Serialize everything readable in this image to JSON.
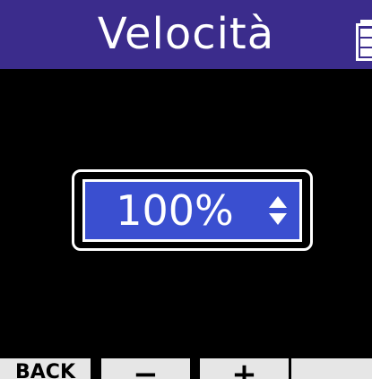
{
  "header": {
    "title": "Velocità",
    "battery_icon": "battery-icon"
  },
  "main": {
    "value": "100%",
    "stepper_icon": "up-down-arrows-icon"
  },
  "softkeys": [
    {
      "label": "BACK"
    },
    {
      "label": "−",
      "icon": "minus-icon"
    },
    {
      "label": "+",
      "icon": "plus-icon"
    },
    {
      "label": ""
    }
  ],
  "colors": {
    "title_bar": "#3b2c8c",
    "value_fill": "#3a4fd0",
    "background": "#000000",
    "softkey_bg": "#e6e6e6",
    "text": "#ffffff"
  }
}
